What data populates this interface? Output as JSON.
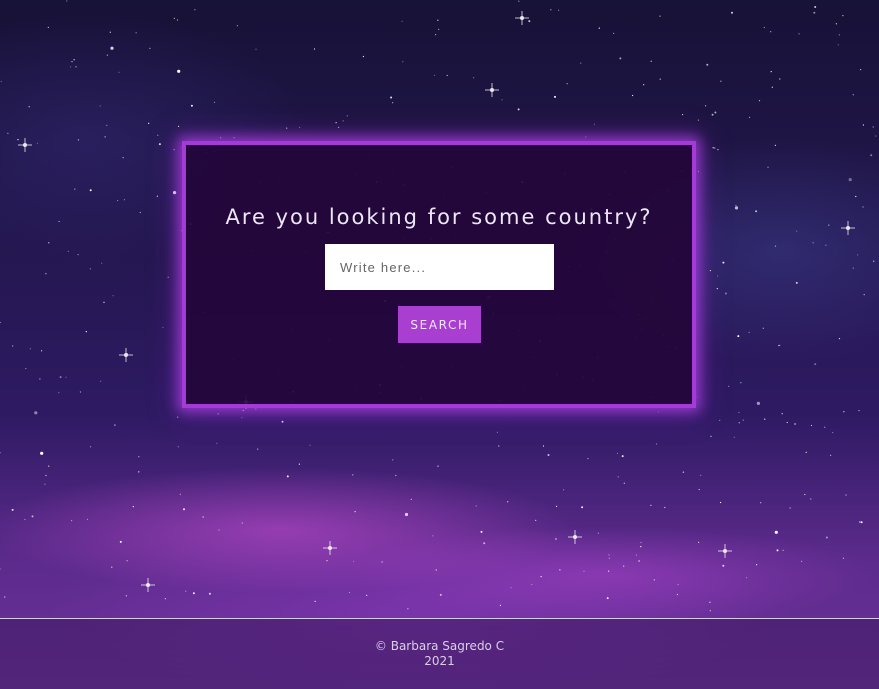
{
  "search": {
    "title": "Are you looking for some country?",
    "placeholder": "Write here...",
    "value": "",
    "button_label": "SEARCH"
  },
  "footer": {
    "copyright": "© Barbara Sagredo C",
    "year": "2021"
  },
  "colors": {
    "accent": "#a93fd0",
    "card_background": "#23063a",
    "card_border": "#a63ad8",
    "background": "#24174f"
  }
}
